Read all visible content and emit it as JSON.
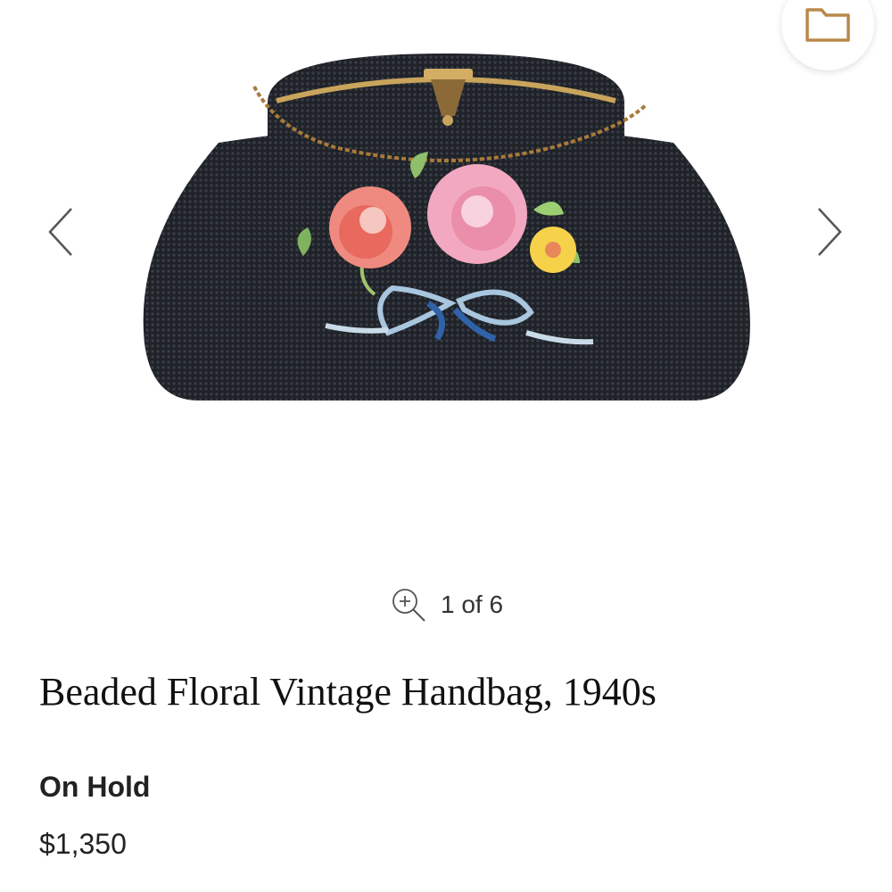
{
  "toolbar": {
    "folder_icon": "folder-icon"
  },
  "gallery": {
    "prev_icon": "chevron-left-icon",
    "next_icon": "chevron-right-icon",
    "zoom_icon": "zoom-in-icon",
    "counter": "1 of 6"
  },
  "product": {
    "title": "Beaded Floral Vintage Handbag, 1940s",
    "status": "On Hold",
    "price": "$1,350"
  },
  "colors": {
    "accent_gold": "#b8894a",
    "bag": "#22252b",
    "text": "#222222"
  }
}
